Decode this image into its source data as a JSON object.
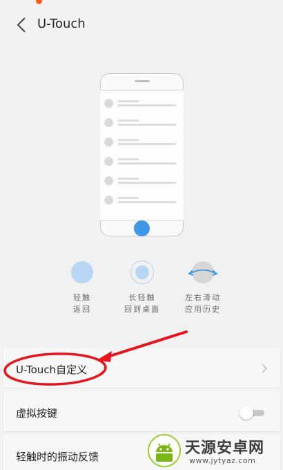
{
  "header": {
    "title": "U-Touch",
    "back_icon": "chevron-left-icon"
  },
  "gestures": [
    {
      "label": "轻触\n返回",
      "icon": "tap-circle-icon",
      "color": "#b6d6f2"
    },
    {
      "label": "长轻触\n回到桌面",
      "icon": "long-press-circle-icon",
      "color": "#b6d6f2"
    },
    {
      "label": "左右滑动\n应用历史",
      "icon": "swipe-arc-icon",
      "color": "#d6d6d6"
    }
  ],
  "phone_illustration": {
    "home_button_color": "#3d96e6",
    "row_count": 6
  },
  "settings": [
    {
      "label": "U-Touch自定义",
      "control": "chevron-right-icon"
    },
    {
      "label": "虚拟按键",
      "control": "toggle",
      "enabled": false
    },
    {
      "label": "轻触时的振动反馈",
      "control": "toggle"
    }
  ],
  "annotation": {
    "color": "#e8141b",
    "target": "U-Touch自定义"
  },
  "watermark": {
    "name": "天源安卓网",
    "url": "www.jytyaz.com"
  }
}
